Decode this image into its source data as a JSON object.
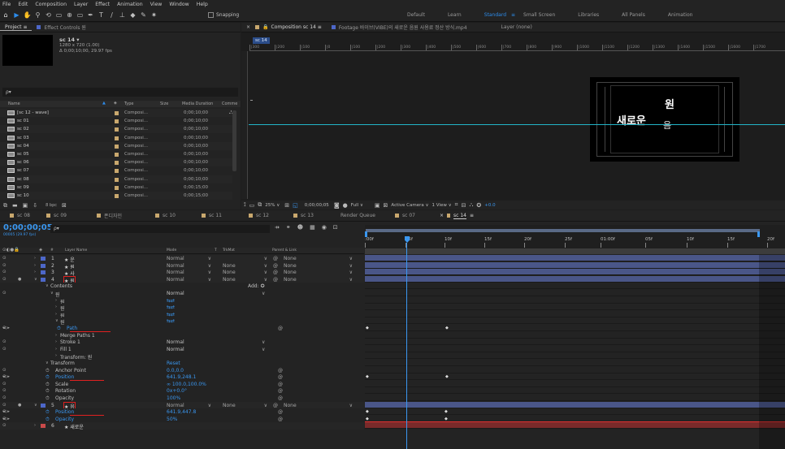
{
  "menu": [
    "File",
    "Edit",
    "Composition",
    "Layer",
    "Effect",
    "Animation",
    "View",
    "Window",
    "Help"
  ],
  "toolbar": {
    "snapping": "Snapping",
    "workspaces": [
      "Default",
      "Learn",
      "Standard",
      "Small Screen",
      "Libraries",
      "All Panels",
      "Animation"
    ],
    "active_workspace": "Standard"
  },
  "project": {
    "tab1": "Project",
    "tab2": "Effect Controls 원",
    "comp_name": "sc 14 ▾",
    "comp_res": "1280 x 720 (1.00)",
    "comp_dur": "Δ 0;00;10;00, 29.97 fps",
    "search_placeholder": "ρ▾",
    "columns": {
      "name": "Name",
      "type": "Type",
      "size": "Size",
      "duration": "Media Duration",
      "comment": "Comme"
    },
    "items": [
      {
        "name": "[sc 12 - wave]",
        "type": "Composi...",
        "dur": "0;00;10;00"
      },
      {
        "name": "sc 01",
        "type": "Composi...",
        "dur": "0;00;10;00"
      },
      {
        "name": "sc 02",
        "type": "Composi...",
        "dur": "0;00;10;00"
      },
      {
        "name": "sc 03",
        "type": "Composi...",
        "dur": "0;00;10;00"
      },
      {
        "name": "sc 04",
        "type": "Composi...",
        "dur": "0;00;10;00"
      },
      {
        "name": "sc 05",
        "type": "Composi...",
        "dur": "0;00;10;00"
      },
      {
        "name": "sc 06",
        "type": "Composi...",
        "dur": "0;00;10;00"
      },
      {
        "name": "sc 07",
        "type": "Composi...",
        "dur": "0;00;10;00"
      },
      {
        "name": "sc 08",
        "type": "Composi...",
        "dur": "0;00;10;00"
      },
      {
        "name": "sc 09",
        "type": "Composi...",
        "dur": "0;00;15;00"
      },
      {
        "name": "sc 10",
        "type": "Composi...",
        "dur": "0;00;15;00"
      }
    ],
    "bpc": "8 bpc"
  },
  "viewer": {
    "comp_tab": "Composition sc 14",
    "footage_tab": "Footage 바이브(VIBE)의 새로운 음원 사용료 정산 방식.mp4",
    "layer_tab": "Layer (none)",
    "comp_chip": "sc 14",
    "ruler": [
      "|300",
      "|200",
      "|100",
      "|0",
      "|100",
      "|200",
      "|300",
      "|400",
      "|500",
      "|600",
      "|700",
      "|800",
      "|900",
      "|1000",
      "|1100",
      "|1200",
      "|1300",
      "|1400",
      "|1500",
      "|1600",
      "|1700"
    ],
    "text_top": "원",
    "text_main": "새로운",
    "text_sub": "음",
    "zoom": "25%",
    "time": "0;00;00;05",
    "quality": "Full",
    "camera": "Active Camera",
    "view": "1 View",
    "exposure": "+0.0"
  },
  "timeline": {
    "tabs": [
      "sc 08",
      "sc 09",
      "폰디자인",
      "sc 10",
      "sc 11",
      "sc 12",
      "sc 13",
      "Render Queue",
      "sc 07",
      "sc 14"
    ],
    "active_tab": "sc 14",
    "time": "0;00;00;05",
    "fps": "00005 (29.97 fps)",
    "search": "ρ▾",
    "headers": {
      "layer": "Layer Name",
      "mode": "Mode",
      "t": "T",
      "trkmat": "TrkMat",
      "parent": "Parent & Link"
    },
    "ruler_labels": [
      ":00f",
      "05f",
      "10f",
      "15f",
      "20f",
      "25f",
      "01:00f",
      "05f",
      "10f",
      "15f",
      "20f"
    ],
    "add_label": "Add:",
    "rows": [
      {
        "kind": "layer",
        "num": "1",
        "name": "★ 운",
        "mode": "Normal",
        "trk": "",
        "parent": "None"
      },
      {
        "kind": "layer",
        "num": "2",
        "name": "★ 원",
        "mode": "Normal",
        "trk": "None",
        "parent": "None"
      },
      {
        "kind": "layer",
        "num": "3",
        "name": "★ 사",
        "mode": "Normal",
        "trk": "None",
        "parent": "None"
      },
      {
        "kind": "layer",
        "num": "4",
        "name": "★ 원",
        "mode": "Normal",
        "trk": "None",
        "parent": "None"
      },
      {
        "kind": "prop",
        "indent": 1,
        "name": "Contents",
        "value": ""
      },
      {
        "kind": "prop",
        "indent": 2,
        "name": "원",
        "value": "Normal"
      },
      {
        "kind": "prop",
        "indent": 3,
        "name": "원",
        "value": "⇆⇄"
      },
      {
        "kind": "prop",
        "indent": 3,
        "name": "원",
        "value": "⇆⇄"
      },
      {
        "kind": "prop",
        "indent": 3,
        "name": "원",
        "value": "⇆⇄"
      },
      {
        "kind": "prop",
        "indent": 3,
        "name": "원",
        "value": "⇆⇄"
      },
      {
        "kind": "prop",
        "indent": 4,
        "name": "Path",
        "value": "",
        "stopwatch": true
      },
      {
        "kind": "prop",
        "indent": 3,
        "name": "Merge Paths 1",
        "value": ""
      },
      {
        "kind": "prop",
        "indent": 3,
        "name": "Stroke 1",
        "value": "Normal"
      },
      {
        "kind": "prop",
        "indent": 3,
        "name": "Fill 1",
        "value": "Normal"
      },
      {
        "kind": "prop",
        "indent": 3,
        "name": "Transform: 원",
        "value": ""
      },
      {
        "kind": "prop",
        "indent": 1,
        "name": "Transform",
        "value": "Reset"
      },
      {
        "kind": "prop",
        "indent": 2,
        "name": "Anchor Point",
        "value": "0.0,0.0"
      },
      {
        "kind": "prop",
        "indent": 2,
        "name": "Position",
        "value": "641.9,248.1",
        "stopwatch": true
      },
      {
        "kind": "prop",
        "indent": 2,
        "name": "Scale",
        "value": "∞ 100.0,100.0%"
      },
      {
        "kind": "prop",
        "indent": 2,
        "name": "Rotation",
        "value": "0x+0.0°"
      },
      {
        "kind": "prop",
        "indent": 2,
        "name": "Opacity",
        "value": "100%"
      },
      {
        "kind": "layer",
        "num": "5",
        "name": "★ 음",
        "mode": "Normal",
        "trk": "None",
        "parent": "None"
      },
      {
        "kind": "prop",
        "indent": 2,
        "name": "Position",
        "value": "641.9,447.8",
        "stopwatch": true
      },
      {
        "kind": "prop",
        "indent": 2,
        "name": "Opacity",
        "value": "50%",
        "stopwatch": true
      },
      {
        "kind": "layer",
        "num": "6",
        "name": "★ 새로운",
        "mode": "",
        "trk": "",
        "parent": ""
      }
    ]
  },
  "colors": {
    "accent": "#2d8ceb",
    "comp_label": "#c9a86e",
    "layer_label": "#4d67c9",
    "guide_line": "#22b5c8",
    "highlight": "#e02020"
  }
}
